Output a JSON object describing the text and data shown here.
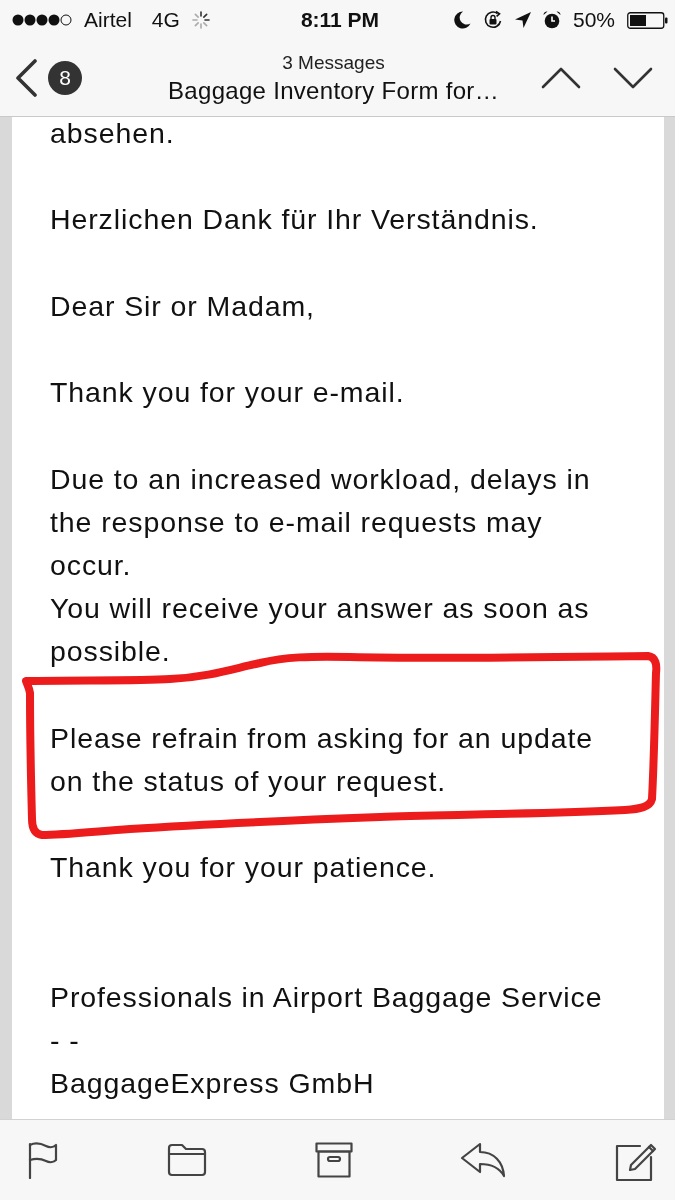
{
  "status_bar": {
    "carrier": "Airtel",
    "network": "4G",
    "time": "8:11 PM",
    "battery_percent": "50%"
  },
  "nav_bar": {
    "unread_count": "8",
    "message_count": "3 Messages",
    "title": "Baggage Inventory Form for…"
  },
  "message": {
    "paragraphs": [
      {
        "kind": "text",
        "circled": false,
        "lines": [
          "absehen."
        ]
      },
      {
        "kind": "text",
        "circled": false,
        "lines": [
          "Herzlichen Dank für Ihr Verständnis."
        ]
      },
      {
        "kind": "text",
        "circled": false,
        "lines": [
          "Dear Sir or Madam,"
        ]
      },
      {
        "kind": "text",
        "circled": false,
        "lines": [
          "Thank you for your e-mail."
        ]
      },
      {
        "kind": "text",
        "circled": false,
        "lines": [
          "Due to an increased workload, delays in the response to e-mail requests may occur.",
          "You will receive your answer as soon as possible."
        ]
      },
      {
        "kind": "text",
        "circled": true,
        "lines": [
          "Please refrain from asking for an update on the status of your request."
        ]
      },
      {
        "kind": "text",
        "circled": false,
        "lines": [
          "Thank you for your patience."
        ]
      },
      {
        "kind": "signature",
        "circled": false,
        "lines": [
          "Professionals in Airport Baggage Service",
          "- -",
          "BaggageExpress GmbH"
        ]
      }
    ]
  }
}
